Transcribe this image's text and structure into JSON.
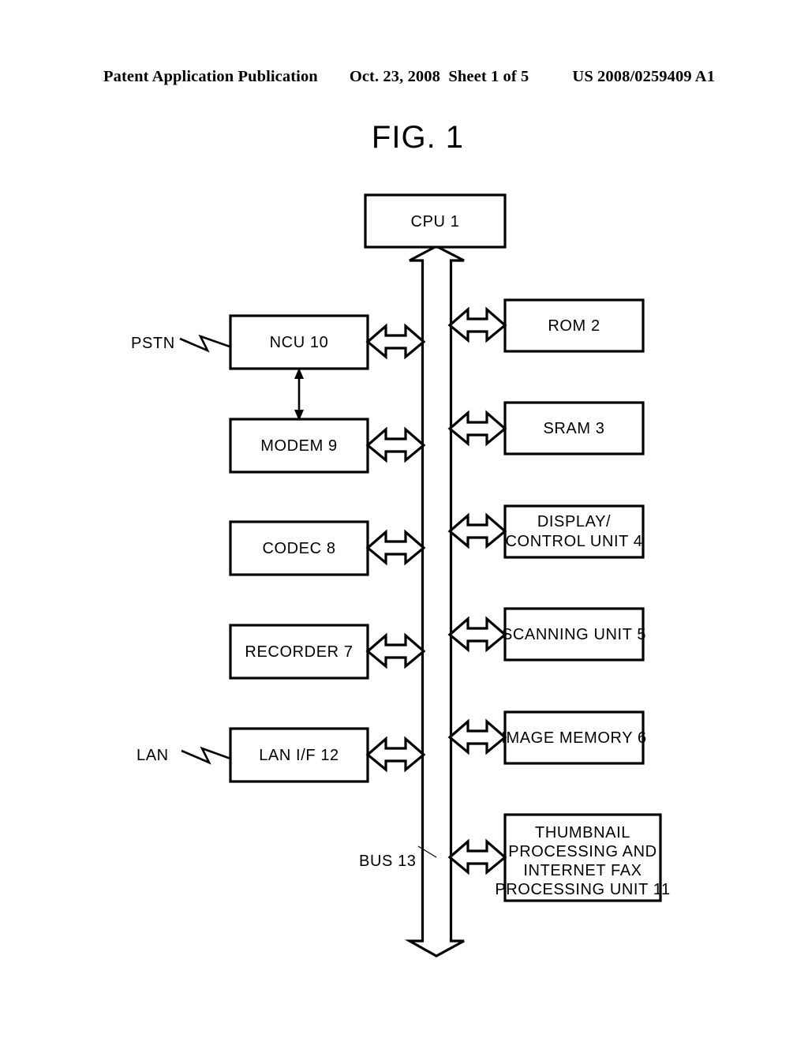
{
  "header": {
    "left": "Patent Application Publication",
    "middle": "Oct. 23, 2008  Sheet 1 of 5",
    "right": "US 2008/0259409 A1"
  },
  "figure": {
    "title": "FIG. 1",
    "line_color": "#000000",
    "fill_color": "#ffffff"
  },
  "blocks": {
    "cpu": "CPU 1",
    "rom": "ROM 2",
    "sram": "SRAM 3",
    "display_line1": "DISPLAY/",
    "display_line2": "CONTROL UNIT 4",
    "scanning": "SCANNING UNIT 5",
    "image_memory": "IMAGE MEMORY 6",
    "thumb_line1": "THUMBNAIL",
    "thumb_line2": "PROCESSING AND",
    "thumb_line3": "INTERNET FAX",
    "thumb_line4": "PROCESSING UNIT 11",
    "ncu": "NCU 10",
    "modem": "MODEM 9",
    "codec": "CODEC 8",
    "recorder": "RECORDER 7",
    "lanif": "LAN I/F 12"
  },
  "labels": {
    "pstn": "PSTN",
    "lan": "LAN",
    "bus": "BUS 13"
  }
}
